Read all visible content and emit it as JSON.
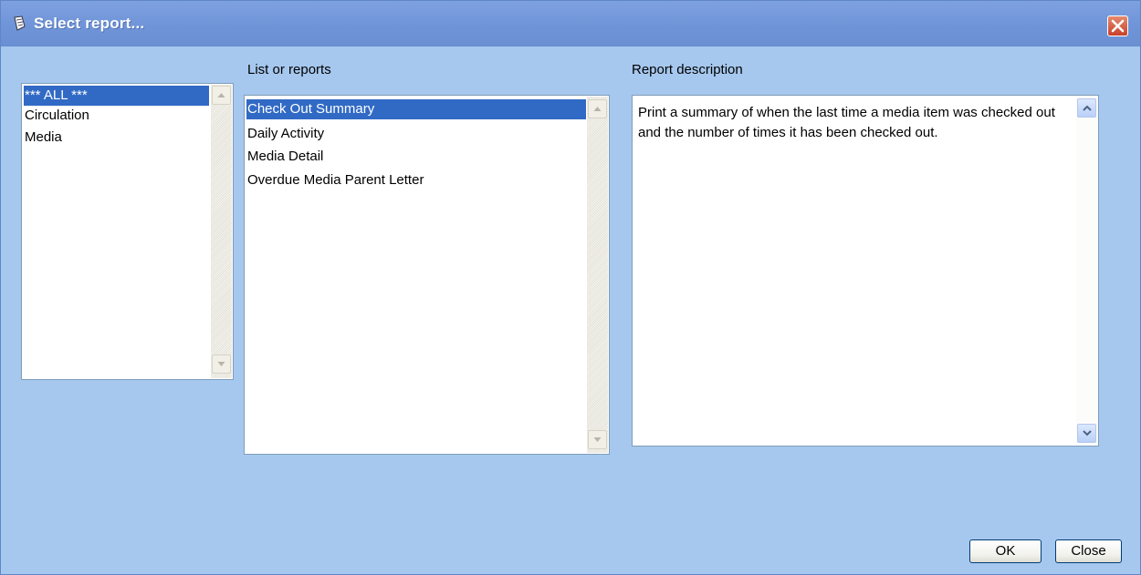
{
  "window": {
    "title": "Select report...",
    "close_icon": "close-icon"
  },
  "categories": {
    "items": [
      "*** ALL ***",
      "Circulation",
      "Media"
    ],
    "selected": "*** ALL ***"
  },
  "reports": {
    "label": "List or reports",
    "items": [
      "Check Out Summary",
      "Daily Activity",
      "Media Detail",
      "Overdue Media Parent Letter"
    ],
    "selected": "Check Out Summary"
  },
  "description": {
    "label": "Report description",
    "text": "Print a summary of when the last time a media item was checked out and the number of times it has been checked out."
  },
  "buttons": {
    "ok": "OK",
    "close": "Close"
  },
  "colors": {
    "dialog_bg": "#a6c8ee",
    "titlebar": "#7a9de0",
    "selection": "#316ac5"
  }
}
